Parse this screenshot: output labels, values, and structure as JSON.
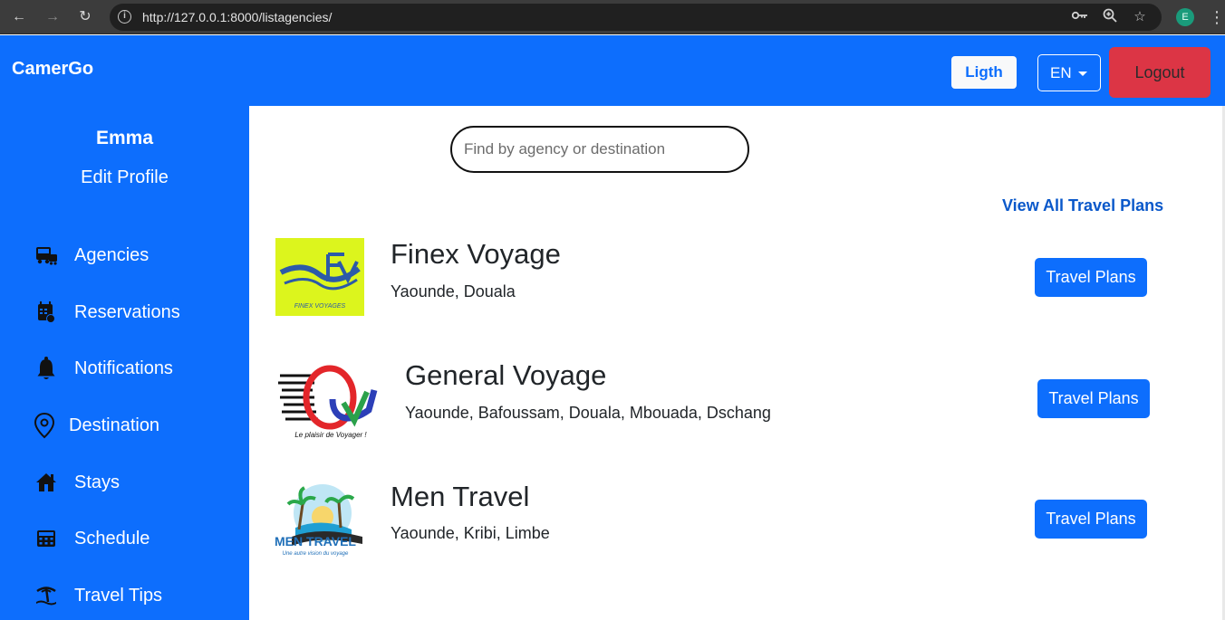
{
  "browser": {
    "url": "http://127.0.0.1:8000/listagencies/",
    "profile_initial": "E"
  },
  "header": {
    "brand": "CamerGo",
    "theme_label": "Ligth",
    "language": "EN",
    "logout_label": "Logout"
  },
  "sidebar": {
    "user_name": "Emma",
    "edit_profile": "Edit Profile",
    "items": [
      {
        "label": "Agencies",
        "icon": "bus-icon"
      },
      {
        "label": "Reservations",
        "icon": "calendar-icon"
      },
      {
        "label": "Notifications",
        "icon": "bell-icon"
      },
      {
        "label": "Destination",
        "icon": "map-pin-icon"
      },
      {
        "label": "Stays",
        "icon": "house-icon"
      },
      {
        "label": "Schedule",
        "icon": "calculator-icon"
      },
      {
        "label": "Travel Tips",
        "icon": "island-icon"
      }
    ]
  },
  "main": {
    "search_placeholder": "Find by agency or destination",
    "view_all_label": "View All Travel Plans",
    "agencies": [
      {
        "name": "Finex Voyage",
        "destinations": "Yaounde, Douala",
        "button": "Travel Plans"
      },
      {
        "name": "General Voyage",
        "destinations": "Yaounde, Bafoussam, Douala, Mbouada, Dschang",
        "button": "Travel Plans"
      },
      {
        "name": "Men Travel",
        "destinations": "Yaounde, Kribi, Limbe",
        "button": "Travel Plans"
      }
    ]
  },
  "logos": {
    "finex_text": "FINEX VOYAGES",
    "general_text": "Le plaisir de Voyager !",
    "men_text": "MEN TRAVEL",
    "men_subtext": "Une autre vision du voyage"
  },
  "colors": {
    "primary": "#0d6efd",
    "danger": "#dc3545",
    "link": "#0a58ca"
  }
}
